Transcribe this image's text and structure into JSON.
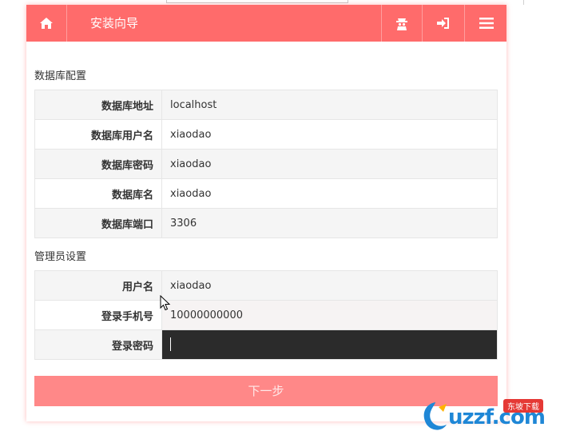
{
  "header": {
    "title": "安装向导",
    "icons": [
      "home-icon",
      "user-hacker-icon",
      "sign-in-icon",
      "menu-icon"
    ]
  },
  "database": {
    "section_title": "数据库配置",
    "rows": [
      {
        "label": "数据库地址",
        "value": "localhost"
      },
      {
        "label": "数据库用户名",
        "value": "xiaodao"
      },
      {
        "label": "数据库密码",
        "value": "xiaodao"
      },
      {
        "label": "数据库名",
        "value": "xiaodao"
      },
      {
        "label": "数据库端口",
        "value": "3306"
      }
    ]
  },
  "admin": {
    "section_title": "管理员设置",
    "rows": [
      {
        "label": "用户名",
        "value": "xiaodao"
      },
      {
        "label": "登录手机号",
        "value": "10000000000"
      },
      {
        "label": "登录密码",
        "value": ""
      }
    ]
  },
  "next_button": {
    "label": "下一步"
  },
  "watermark": {
    "text": "uzzf.com",
    "badge": "东坡下载"
  },
  "colors": {
    "accent": "#ff6b6b",
    "button": "#ff8888",
    "password_field": "#2b2b2b"
  }
}
